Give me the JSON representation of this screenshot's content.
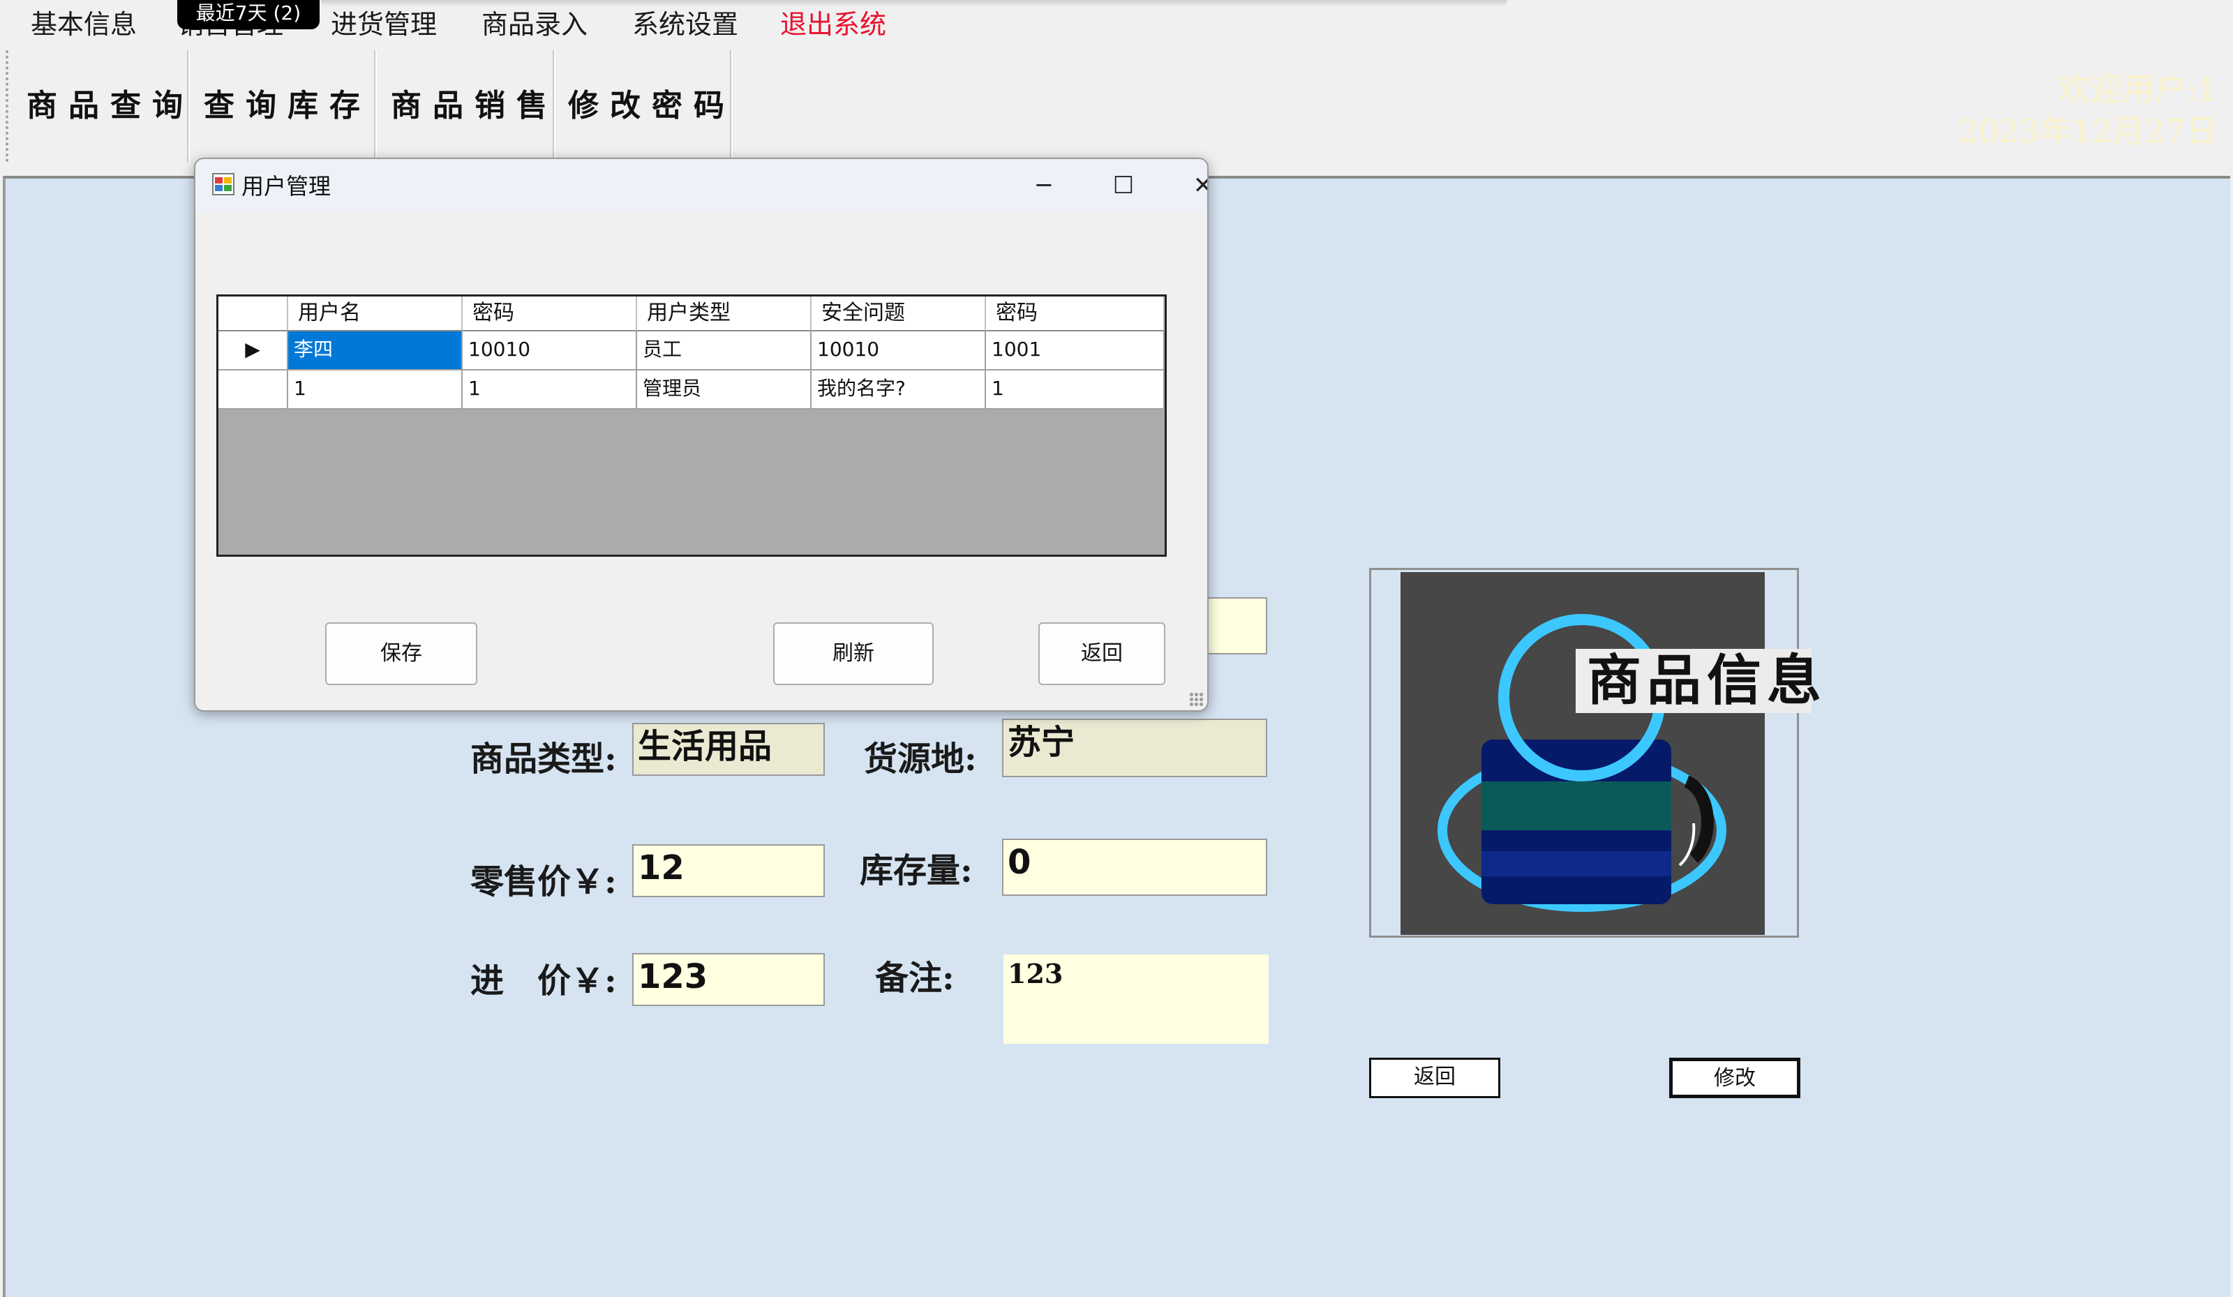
{
  "menu": {
    "items": [
      "基本信息",
      "进货管理",
      "商品录入",
      "系统设置"
    ],
    "exit_label": "退出系统",
    "tooltip": "最近7天 (2)"
  },
  "toolbar": {
    "buttons": [
      "商品查询",
      "查询库存",
      "商品销售",
      "修改密码"
    ],
    "welcome": "欢迎用户:1",
    "date": "2023年12月27日"
  },
  "form": {
    "category_label": "商品类型:",
    "category_value": "生活用品",
    "origin_label": "货源地:",
    "origin_value": "苏宁",
    "retail_label": "零售价￥:",
    "retail_value": "12",
    "stock_label": "库存量:",
    "stock_value": "0",
    "purchase_label": "进　价￥:",
    "purchase_value": "123",
    "note_label": "备注:",
    "note_value": "123",
    "image_caption": "商品信息",
    "back_button": "返回",
    "modify_button": "修改"
  },
  "dialog": {
    "title": "用户管理",
    "columns": [
      "用户名",
      "密码",
      "用户类型",
      "安全问题",
      "密码"
    ],
    "rows": [
      [
        "李四",
        "10010",
        "员工",
        "10010",
        "1001"
      ],
      [
        "1",
        "1",
        "管理员",
        "我的名字?",
        "1"
      ]
    ],
    "save_button": "保存",
    "refresh_button": "刷新",
    "back_button": "返回",
    "minimize": "─",
    "maximize": "☐",
    "close": "✕"
  }
}
